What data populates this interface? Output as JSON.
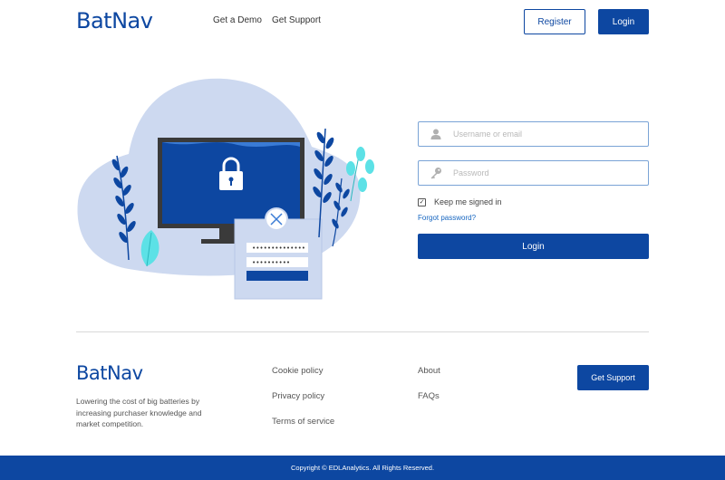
{
  "header": {
    "logo": "BatNav",
    "nav": [
      "Get a Demo",
      "Get Support"
    ],
    "register_label": "Register",
    "login_label": "Login"
  },
  "login_form": {
    "username_placeholder": "Username or email",
    "password_placeholder": "Password",
    "keep_signed_in_label": "Keep me signed in",
    "keep_signed_in_checked": true,
    "forgot_password_label": "Forgot password?",
    "submit_label": "Login"
  },
  "footer": {
    "logo": "BatNav",
    "description": "Lowering the cost of big batteries by increasing purchaser knowledge and market competition.",
    "links_col1": [
      "Cookie policy",
      "Privacy policy",
      "Terms of service"
    ],
    "links_col2": [
      "About",
      "FAQs"
    ],
    "support_label": "Get Support",
    "copyright": "Copyright © EDLAnalytics. All Rights Reserved."
  },
  "colors": {
    "brand": "#0d47a1",
    "blob": "#cdd9f0",
    "accent_cyan": "#5ce1e6"
  },
  "icons": {
    "username_field": "user-icon",
    "password_field": "key-icon",
    "monitor": "lock-icon",
    "dialog_close": "close-icon"
  }
}
